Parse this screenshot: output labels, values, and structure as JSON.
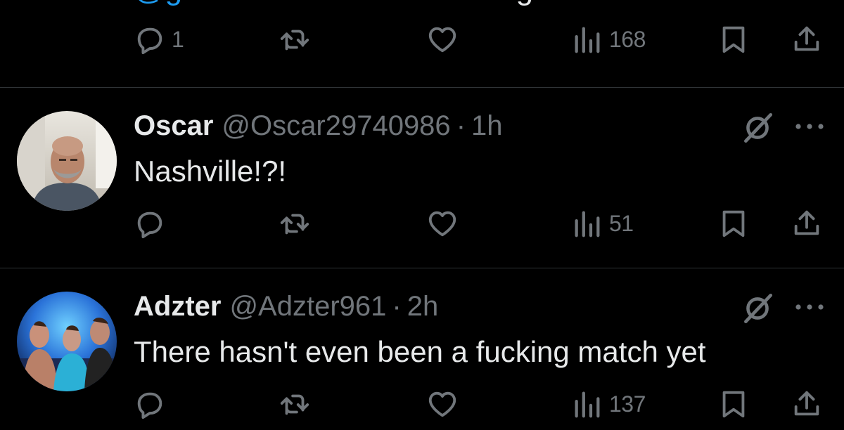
{
  "top_partial": {
    "mention": "@grok",
    "text": " how does this ranking work?"
  },
  "first_actions": {
    "reply_count": "1",
    "retweet_count": "",
    "like_count": "",
    "views_count": "168"
  },
  "tweets": [
    {
      "name": "Oscar",
      "handle": "@Oscar29740986",
      "separator": "·",
      "time": "1h",
      "text": "Nashville!?!",
      "reply_count": "",
      "retweet_count": "",
      "like_count": "",
      "views_count": "51"
    },
    {
      "name": "Adzter",
      "handle": "@Adzter961",
      "separator": "·",
      "time": "2h",
      "text": "There hasn't even been a fucking match yet",
      "reply_count": "",
      "retweet_count": "",
      "like_count": "",
      "views_count": "137"
    }
  ],
  "icons": {
    "reply": "reply-icon",
    "retweet": "retweet-icon",
    "like": "heart-icon",
    "views": "views-icon",
    "bookmark": "bookmark-icon",
    "share": "share-icon",
    "grok": "grok-icon",
    "more": "more-icon"
  },
  "colors": {
    "background": "#000000",
    "text": "#e7e9ea",
    "muted": "#71767b",
    "accent": "#1d9bf0",
    "divider": "#2f3336"
  }
}
